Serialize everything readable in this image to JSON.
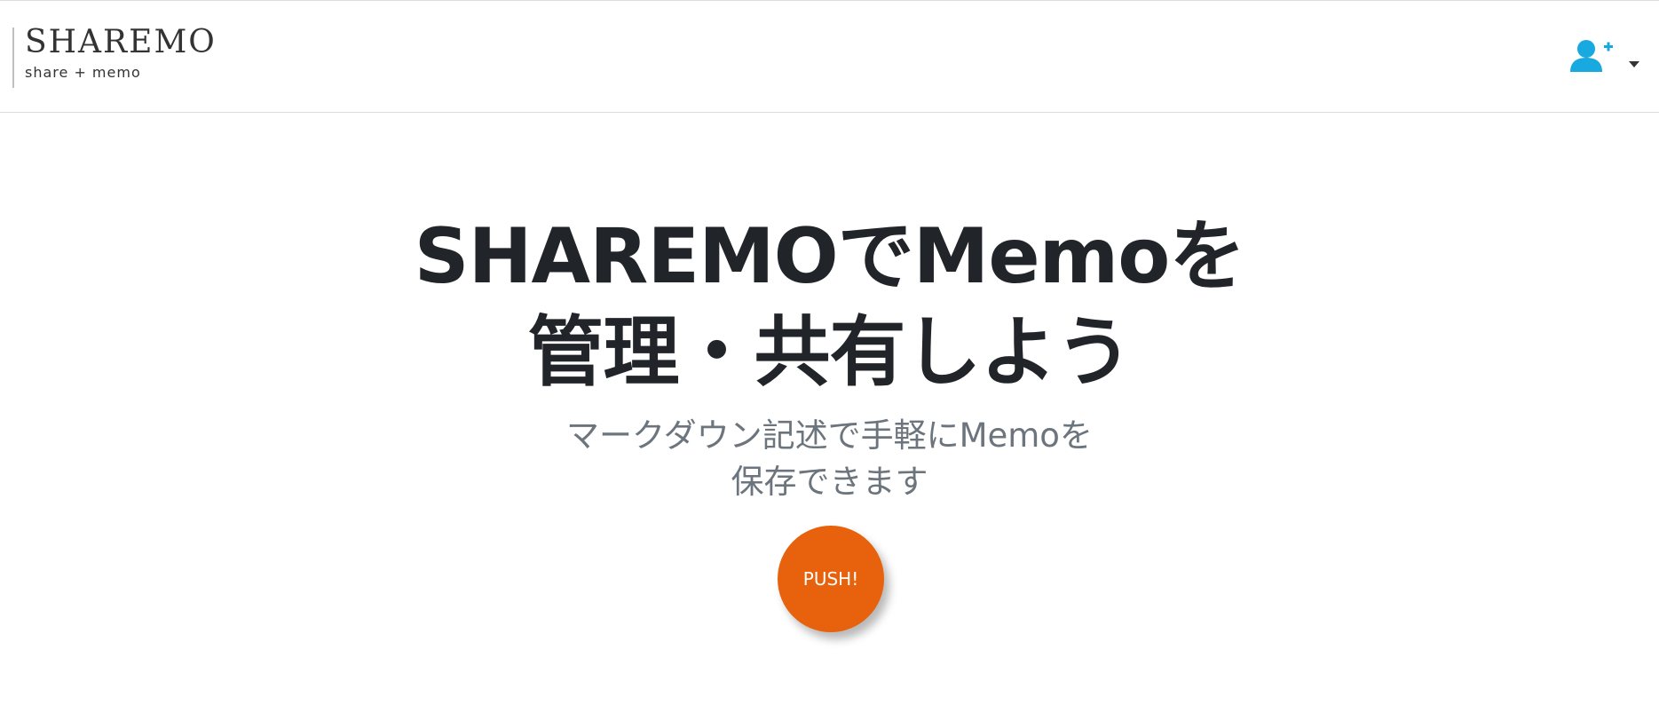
{
  "navbar": {
    "brand_name": "SHAREMO",
    "brand_tagline": "share + memo",
    "user_menu_icon": "user-plus-icon",
    "accent_color": "#17a9e0"
  },
  "hero": {
    "title_line1": "SHAREMOでMemoを",
    "title_line2": "管理・共有しよう",
    "subtitle_line1": "マークダウン記述で手軽にMemoを",
    "subtitle_line2": "保存できます",
    "button_label": "PUSH!",
    "button_color": "#e8610c"
  }
}
